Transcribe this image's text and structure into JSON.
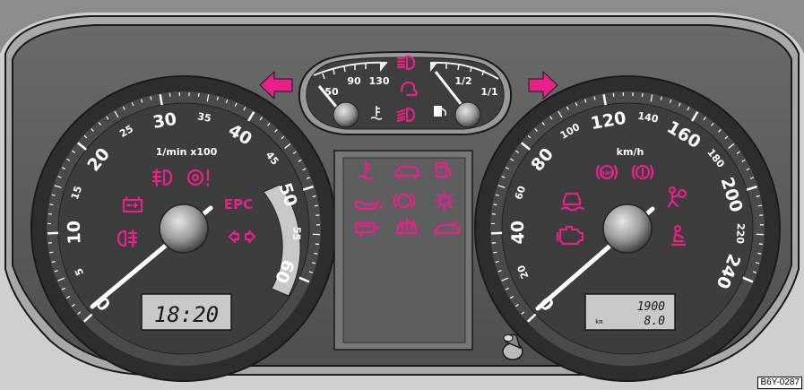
{
  "tachometer": {
    "unit": "1/min x100",
    "major_labels": [
      "0",
      "10",
      "20",
      "30",
      "40",
      "50",
      "60"
    ],
    "minor_labels": [
      "5",
      "15",
      "25",
      "35",
      "45",
      "55"
    ],
    "clock": "18:20"
  },
  "speedometer": {
    "unit": "km/h",
    "major_labels": [
      "0",
      "40",
      "80",
      "120",
      "160",
      "200",
      "240"
    ],
    "minor_labels": [
      "20",
      "60",
      "100",
      "140",
      "180",
      "220"
    ],
    "odometer_total": "1900",
    "odometer_trip": "8.0",
    "odometer_unit": "km"
  },
  "center_gauges": {
    "temp_labels": [
      "50",
      "90",
      "130"
    ],
    "fuel_labels": [
      "1/2",
      "1/1"
    ]
  },
  "icons": {
    "epc_text": "EPC"
  },
  "reference_code": "B6Y-0287",
  "colors": {
    "indicator": "#e8208a",
    "panel": "#5a5a5a",
    "gauge_face": "#3e3e3e",
    "lcd": "#c9c9c9"
  }
}
